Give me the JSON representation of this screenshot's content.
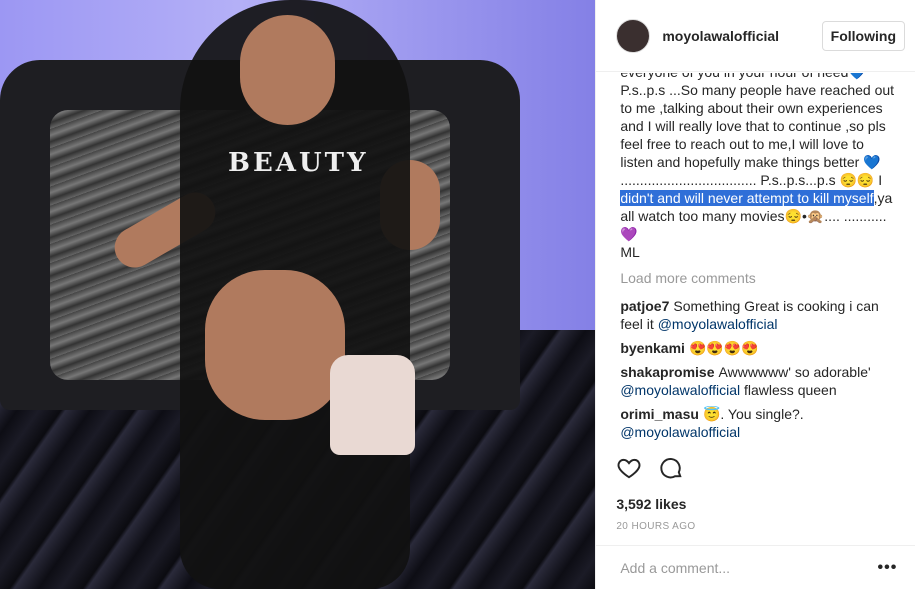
{
  "header": {
    "username": "moyolawalofficial",
    "follow_label": "Following"
  },
  "photo": {
    "shirt_text": "BEAUTY"
  },
  "caption": {
    "before_highlight": "everyone of you in your hour of need💙\nP.s..p.s ...So many people have reached out to me ,talking about their own experiences and I will really love that to continue ,so pls feel free to reach out to me,I will love to listen and hopefully make things better 💙 ................................... P.s..p.s...p.s 😔😔 I ",
    "highlight": "didn't and will never attempt to kill myself",
    "after_highlight": ",ya all watch too many movies😔•🙊.... ........... 💜\nML"
  },
  "load_more": "Load more comments",
  "comments": [
    {
      "user": "patjoe7",
      "text": "Something Great is cooking i can feel it ",
      "mention": "@moyolawalofficial"
    },
    {
      "user": "byenkami",
      "text": "😍😍😍😍",
      "mention": ""
    },
    {
      "user": "shakapromise",
      "text": "Awwwwww' so adorable' ",
      "mention": "@moyolawalofficial",
      "after": " flawless queen"
    },
    {
      "user": "orimi_masu",
      "text": "😇. You single?. ",
      "mention": "@moyolawalofficial"
    }
  ],
  "actions": {
    "like_icon": "heart-icon",
    "comment_icon": "comment-icon"
  },
  "likes": "3,592 likes",
  "timestamp": "20 HOURS AGO",
  "add_comment_placeholder": "Add a comment...",
  "more_icon": "•••"
}
